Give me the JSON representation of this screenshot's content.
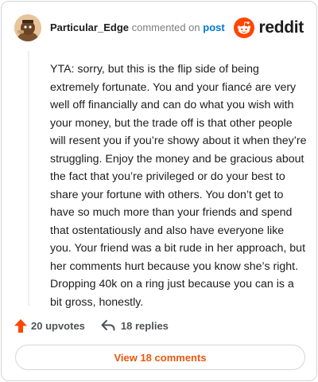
{
  "header": {
    "username": "Particular_Edge",
    "commented_text": "commented on",
    "post_link": "post",
    "logo_text": "reddit",
    "avatar_icon": "snoo-avatar-icon",
    "logo_icon": "reddit-alien-icon"
  },
  "comment": {
    "text": "YTA: sorry, but this is the flip side of being extremely fortunate. You and your fiancé are very well off financially and can do what you wish with your money, but the trade off is that other people will resent you if you’re showy about it when they’re struggling. Enjoy the money and be gracious about the fact that you’re privileged or do your best to share your fortune with others. You don’t get to have so much more than your friends and spend that ostentatiously and also have everyone like you. Your friend was a bit rude in her approach, but her comments hurt because you know she’s right. Dropping 40k on a ring just because you can is a bit gross, honestly."
  },
  "actions": {
    "upvotes": "20 upvotes",
    "replies": "18 replies",
    "upvote_icon": "upvote-arrow-icon",
    "reply_icon": "reply-arrow-icon"
  },
  "footer": {
    "view_comments": "View 18 comments"
  },
  "colors": {
    "accent": "#ff4500",
    "link": "#0079d3",
    "button_text": "#e8590c"
  }
}
